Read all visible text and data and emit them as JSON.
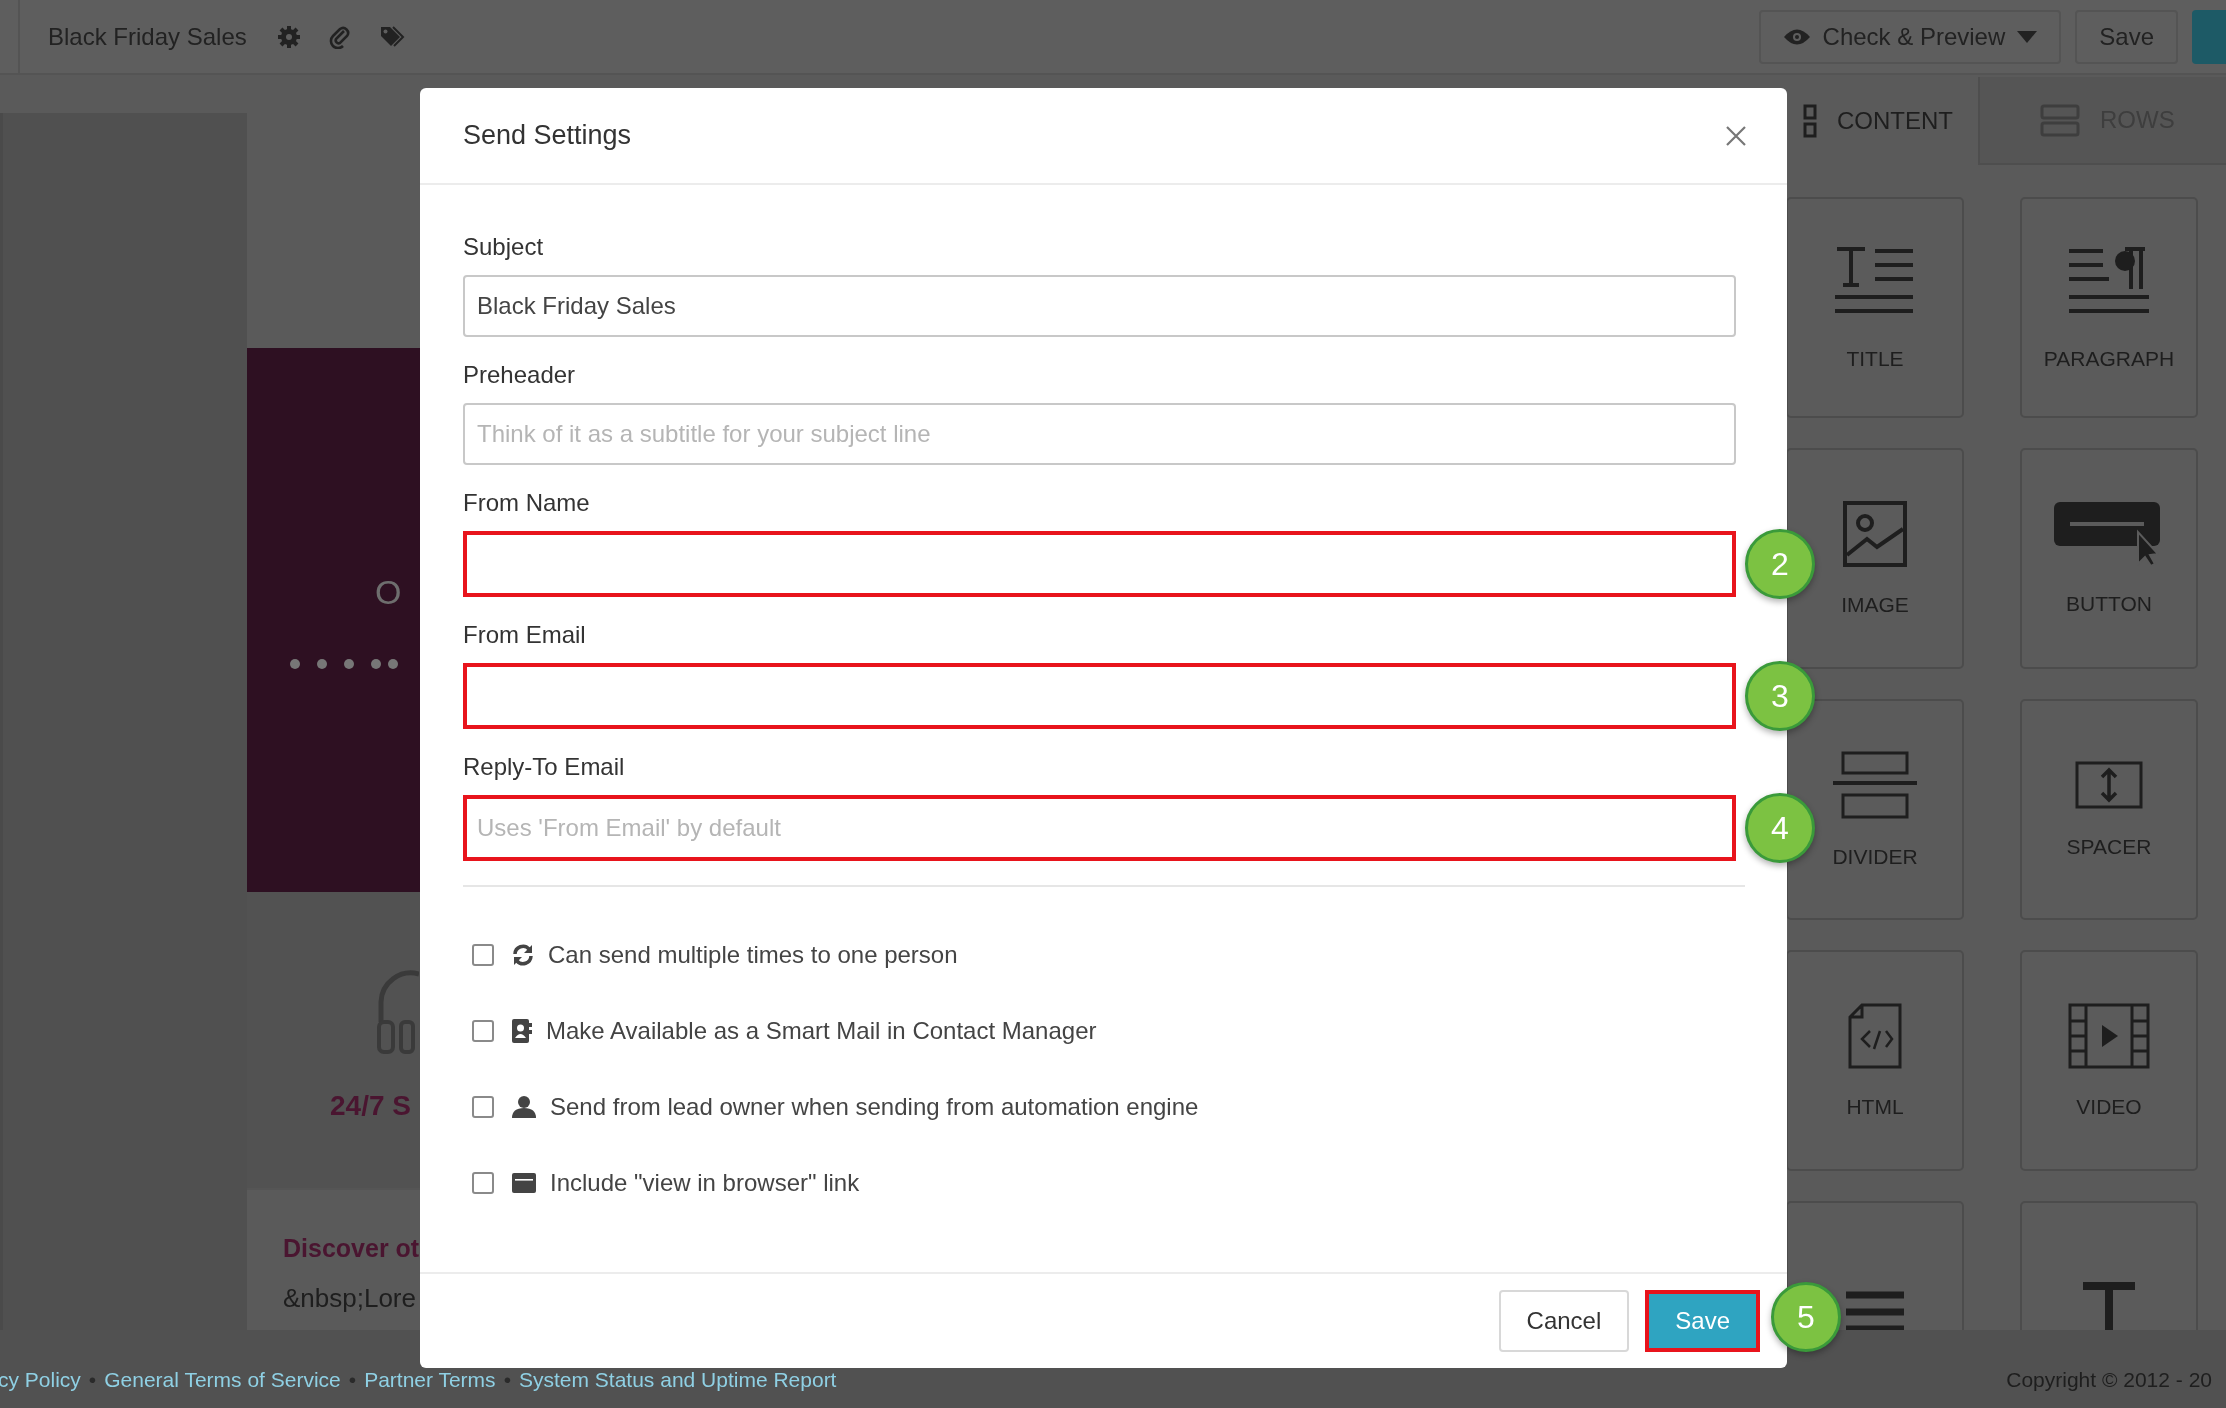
{
  "top_bar": {
    "title": "Black Friday Sales",
    "preview_button": "Check & Preview",
    "save_button": "Save"
  },
  "canvas": {
    "hero_text": "O",
    "support_text": "24/7 S",
    "heading": "Discover ot",
    "body_text": "&nbsp;Lore"
  },
  "right_panel": {
    "tabs": [
      {
        "label": "CONTENT",
        "selected": true,
        "kind": "content"
      },
      {
        "label": "ROWS",
        "selected": false,
        "kind": "rows"
      }
    ],
    "blocks": [
      {
        "label": "TITLE",
        "kind": "title"
      },
      {
        "label": "PARAGRAPH",
        "kind": "paragraph"
      },
      {
        "label": "IMAGE",
        "kind": "image"
      },
      {
        "label": "BUTTON",
        "kind": "button"
      },
      {
        "label": "DIVIDER",
        "kind": "divider"
      },
      {
        "label": "SPACER",
        "kind": "spacer"
      },
      {
        "label": "HTML",
        "kind": "html"
      },
      {
        "label": "VIDEO",
        "kind": "video"
      },
      {
        "kind": "list"
      },
      {
        "kind": "text"
      }
    ]
  },
  "dialog": {
    "title": "Send Settings",
    "fields": [
      {
        "label": "Subject",
        "value": "Black Friday Sales",
        "highlighted": false
      },
      {
        "label": "Preheader",
        "placeholder": "Think of it as a subtitle for your subject line",
        "highlighted": false
      },
      {
        "label": "From Name",
        "highlighted": true,
        "callout": "2"
      },
      {
        "label": "From Email",
        "highlighted": true,
        "callout": "3"
      },
      {
        "label": "Reply-To Email",
        "placeholder": "Uses 'From Email' by default",
        "highlighted": true,
        "callout": "4"
      }
    ],
    "options": [
      {
        "label": "Can send multiple times to one person",
        "kind": "repeat",
        "checked": false
      },
      {
        "label": "Make Available as a Smart Mail in Contact Manager",
        "kind": "contact",
        "checked": false
      },
      {
        "label": "Send from lead owner when sending from automation engine",
        "kind": "person",
        "checked": false
      },
      {
        "label": "Include \"view in browser\" link",
        "kind": "browser",
        "checked": false
      }
    ],
    "buttons": [
      {
        "label": "Cancel",
        "kind": "secondary",
        "highlighted": false
      },
      {
        "label": "Save",
        "kind": "primary",
        "highlighted": true,
        "callout": "5"
      }
    ]
  },
  "footer": {
    "items": [
      {
        "kind": "link",
        "text": "cy Policy"
      },
      {
        "kind": "separator",
        "text": "•"
      },
      {
        "kind": "link",
        "text": "General Terms of Service"
      },
      {
        "kind": "separator",
        "text": "•"
      },
      {
        "kind": "link",
        "text": "Partner Terms"
      },
      {
        "kind": "separator",
        "text": "•"
      },
      {
        "kind": "link",
        "text": "System Status and Uptime Report"
      }
    ],
    "copyright": "Copyright © 2012 - 20"
  }
}
